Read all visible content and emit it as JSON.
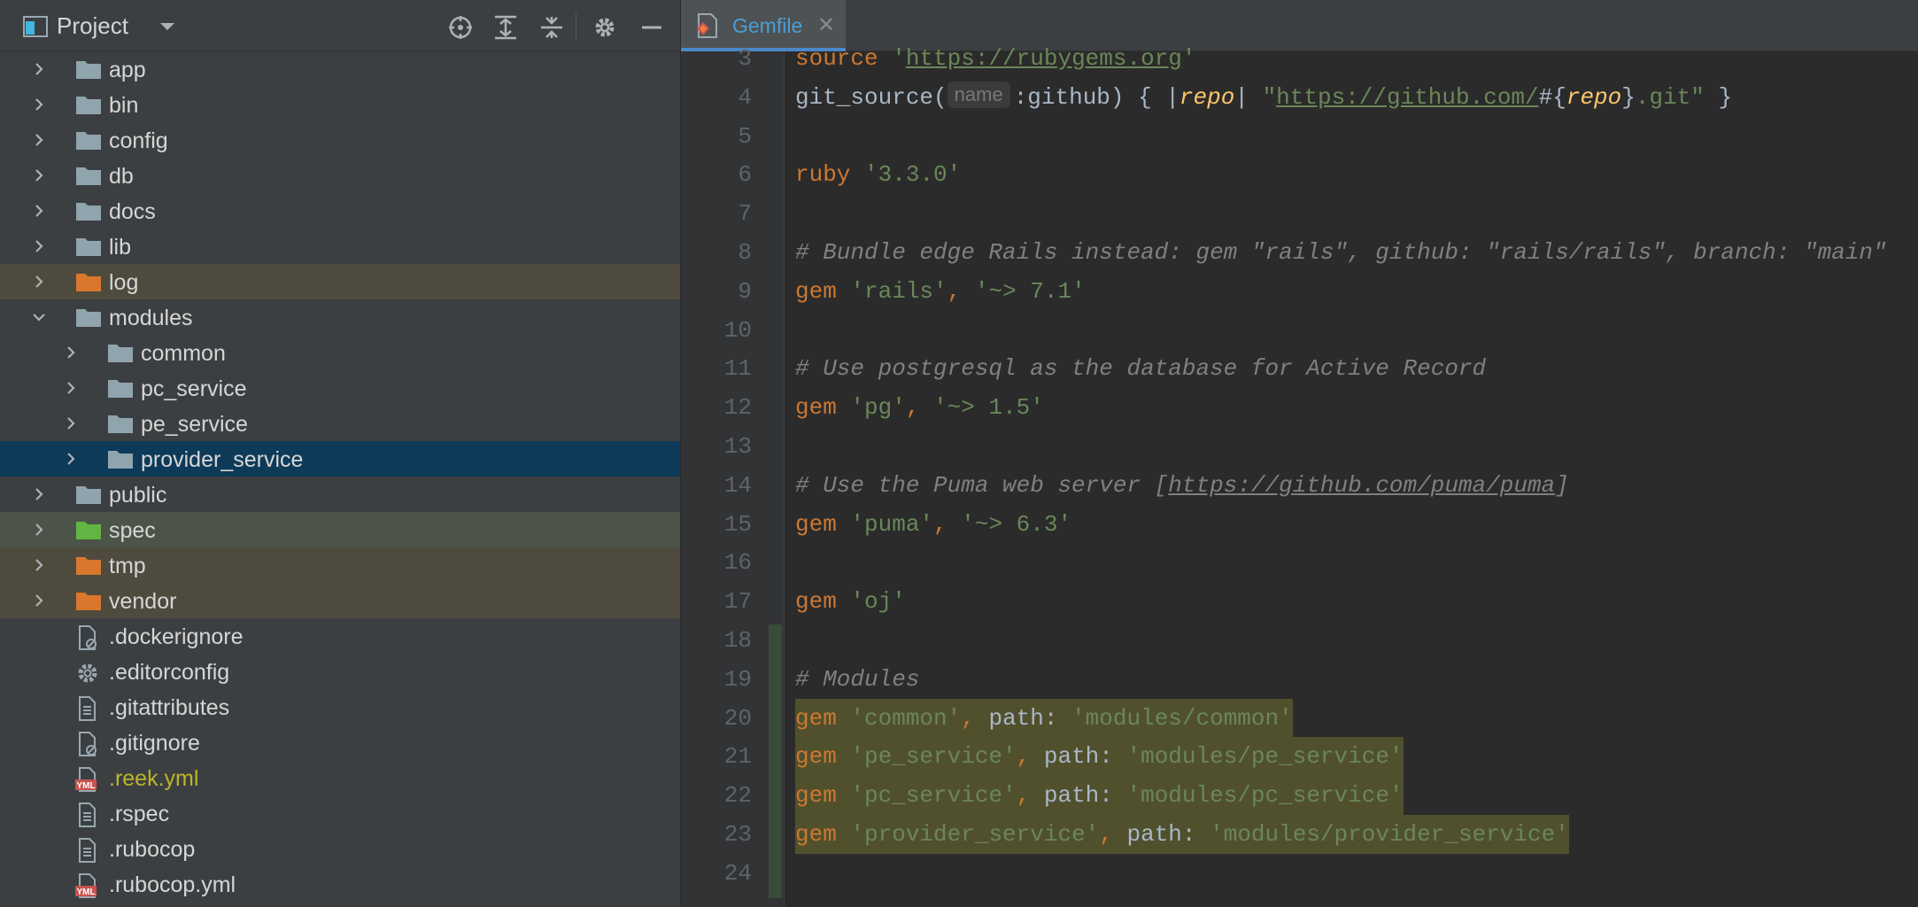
{
  "project_panel": {
    "title": "Project",
    "toolbar": [
      "locate-icon",
      "expand-all-icon",
      "collapse-all-icon",
      "gear-icon",
      "hide-icon"
    ],
    "tree": [
      {
        "label": "app",
        "kind": "folder",
        "depth": 0,
        "expanded": false,
        "highlight": ""
      },
      {
        "label": "bin",
        "kind": "folder",
        "depth": 0,
        "expanded": false,
        "highlight": ""
      },
      {
        "label": "config",
        "kind": "folder",
        "depth": 0,
        "expanded": false,
        "highlight": ""
      },
      {
        "label": "db",
        "kind": "folder",
        "depth": 0,
        "expanded": false,
        "highlight": ""
      },
      {
        "label": "docs",
        "kind": "folder",
        "depth": 0,
        "expanded": false,
        "highlight": ""
      },
      {
        "label": "lib",
        "kind": "folder",
        "depth": 0,
        "expanded": false,
        "highlight": ""
      },
      {
        "label": "log",
        "kind": "folder-orange",
        "depth": 0,
        "expanded": false,
        "highlight": "orange"
      },
      {
        "label": "modules",
        "kind": "folder",
        "depth": 0,
        "expanded": true,
        "highlight": ""
      },
      {
        "label": "common",
        "kind": "folder",
        "depth": 1,
        "expanded": false,
        "highlight": ""
      },
      {
        "label": "pc_service",
        "kind": "folder",
        "depth": 1,
        "expanded": false,
        "highlight": ""
      },
      {
        "label": "pe_service",
        "kind": "folder",
        "depth": 1,
        "expanded": false,
        "highlight": ""
      },
      {
        "label": "provider_service",
        "kind": "folder",
        "depth": 1,
        "expanded": false,
        "highlight": "selected"
      },
      {
        "label": "public",
        "kind": "folder",
        "depth": 0,
        "expanded": false,
        "highlight": ""
      },
      {
        "label": "spec",
        "kind": "folder-green",
        "depth": 0,
        "expanded": false,
        "highlight": "green"
      },
      {
        "label": "tmp",
        "kind": "folder-orange",
        "depth": 0,
        "expanded": false,
        "highlight": "orange"
      },
      {
        "label": "vendor",
        "kind": "folder-orange",
        "depth": 0,
        "expanded": false,
        "highlight": "orange"
      },
      {
        "label": ".dockerignore",
        "kind": "file-ignore",
        "depth": 0,
        "highlight": ""
      },
      {
        "label": ".editorconfig",
        "kind": "file-gear",
        "depth": 0,
        "highlight": ""
      },
      {
        "label": ".gitattributes",
        "kind": "file-text",
        "depth": 0,
        "highlight": ""
      },
      {
        "label": ".gitignore",
        "kind": "file-ignore",
        "depth": 0,
        "highlight": ""
      },
      {
        "label": ".reek.yml",
        "kind": "file-yml",
        "depth": 0,
        "highlight": "",
        "color": "yellow"
      },
      {
        "label": ".rspec",
        "kind": "file-text",
        "depth": 0,
        "highlight": ""
      },
      {
        "label": ".rubocop",
        "kind": "file-text",
        "depth": 0,
        "highlight": ""
      },
      {
        "label": ".rubocop.yml",
        "kind": "file-yml",
        "depth": 0,
        "highlight": ""
      }
    ]
  },
  "editor": {
    "tab": {
      "label": "Gemfile",
      "close": "✕"
    },
    "lines": [
      {
        "n": "3",
        "sel": false,
        "tokens": [
          [
            "kw",
            "source"
          ],
          [
            "pl",
            " "
          ],
          [
            "str",
            "'"
          ],
          [
            "str-u",
            "https://rubygems.org"
          ],
          [
            "str",
            "'"
          ]
        ]
      },
      {
        "n": "4",
        "sel": false,
        "tokens": [
          [
            "pl",
            "git_source("
          ],
          [
            "inlay",
            "name"
          ],
          [
            "pl",
            ":github) { |"
          ],
          [
            "var",
            "repo"
          ],
          [
            "pl",
            "| "
          ],
          [
            "str",
            "\""
          ],
          [
            "str-u",
            "https://github.com/"
          ],
          [
            "pl",
            "#{"
          ],
          [
            "var",
            "repo"
          ],
          [
            "pl",
            "}"
          ],
          [
            "str",
            ".git\""
          ],
          [
            "pl",
            " }"
          ]
        ]
      },
      {
        "n": "5",
        "sel": false,
        "tokens": []
      },
      {
        "n": "6",
        "sel": false,
        "tokens": [
          [
            "kw",
            "ruby"
          ],
          [
            "pl",
            " "
          ],
          [
            "str",
            "'3.3.0'"
          ]
        ]
      },
      {
        "n": "7",
        "sel": false,
        "tokens": []
      },
      {
        "n": "8",
        "sel": false,
        "tokens": [
          [
            "cm",
            "# Bundle edge Rails instead: gem \"rails\", github: \"rails/rails\", branch: \"main\""
          ]
        ]
      },
      {
        "n": "9",
        "sel": false,
        "tokens": [
          [
            "kw",
            "gem"
          ],
          [
            "pl",
            " "
          ],
          [
            "str",
            "'rails'"
          ],
          [
            "kw",
            ","
          ],
          [
            "pl",
            " "
          ],
          [
            "str",
            "'~> 7.1'"
          ]
        ]
      },
      {
        "n": "10",
        "sel": false,
        "tokens": []
      },
      {
        "n": "11",
        "sel": false,
        "tokens": [
          [
            "cm",
            "# Use postgresql as the database for Active Record"
          ]
        ]
      },
      {
        "n": "12",
        "sel": false,
        "tokens": [
          [
            "kw",
            "gem"
          ],
          [
            "pl",
            " "
          ],
          [
            "str",
            "'pg'"
          ],
          [
            "kw",
            ","
          ],
          [
            "pl",
            " "
          ],
          [
            "str",
            "'~> 1.5'"
          ]
        ]
      },
      {
        "n": "13",
        "sel": false,
        "tokens": []
      },
      {
        "n": "14",
        "sel": false,
        "tokens": [
          [
            "cm",
            "# Use the Puma web server ["
          ],
          [
            "cm-u",
            "https://github.com/puma/puma"
          ],
          [
            "cm",
            "]"
          ]
        ]
      },
      {
        "n": "15",
        "sel": false,
        "tokens": [
          [
            "kw",
            "gem"
          ],
          [
            "pl",
            " "
          ],
          [
            "str",
            "'puma'"
          ],
          [
            "kw",
            ","
          ],
          [
            "pl",
            " "
          ],
          [
            "str",
            "'~> 6.3'"
          ]
        ]
      },
      {
        "n": "16",
        "sel": false,
        "tokens": []
      },
      {
        "n": "17",
        "sel": false,
        "tokens": [
          [
            "kw",
            "gem"
          ],
          [
            "pl",
            " "
          ],
          [
            "str",
            "'oj'"
          ]
        ]
      },
      {
        "n": "18",
        "sel": false,
        "tokens": []
      },
      {
        "n": "19",
        "sel": false,
        "tokens": [
          [
            "cm",
            "# Modules"
          ]
        ]
      },
      {
        "n": "20",
        "sel": true,
        "tokens": [
          [
            "kw",
            "gem"
          ],
          [
            "pl",
            " "
          ],
          [
            "str",
            "'common'"
          ],
          [
            "kw",
            ","
          ],
          [
            "pl",
            " path: "
          ],
          [
            "str",
            "'modules/common'"
          ]
        ]
      },
      {
        "n": "21",
        "sel": true,
        "tokens": [
          [
            "kw",
            "gem"
          ],
          [
            "pl",
            " "
          ],
          [
            "str",
            "'pe_service'"
          ],
          [
            "kw",
            ","
          ],
          [
            "pl",
            " path: "
          ],
          [
            "str",
            "'modules/pe_service'"
          ]
        ]
      },
      {
        "n": "22",
        "sel": true,
        "tokens": [
          [
            "kw",
            "gem"
          ],
          [
            "pl",
            " "
          ],
          [
            "str",
            "'pc_service'"
          ],
          [
            "kw",
            ","
          ],
          [
            "pl",
            " path: "
          ],
          [
            "str",
            "'modules/pc_service'"
          ]
        ]
      },
      {
        "n": "23",
        "sel": true,
        "tokens": [
          [
            "kw",
            "gem"
          ],
          [
            "pl",
            " "
          ],
          [
            "str",
            "'provider_service'"
          ],
          [
            "kw",
            ","
          ],
          [
            "pl",
            " path: "
          ],
          [
            "str",
            "'modules/provider_service'"
          ]
        ]
      },
      {
        "n": "24",
        "sel": false,
        "tokens": []
      }
    ]
  }
}
